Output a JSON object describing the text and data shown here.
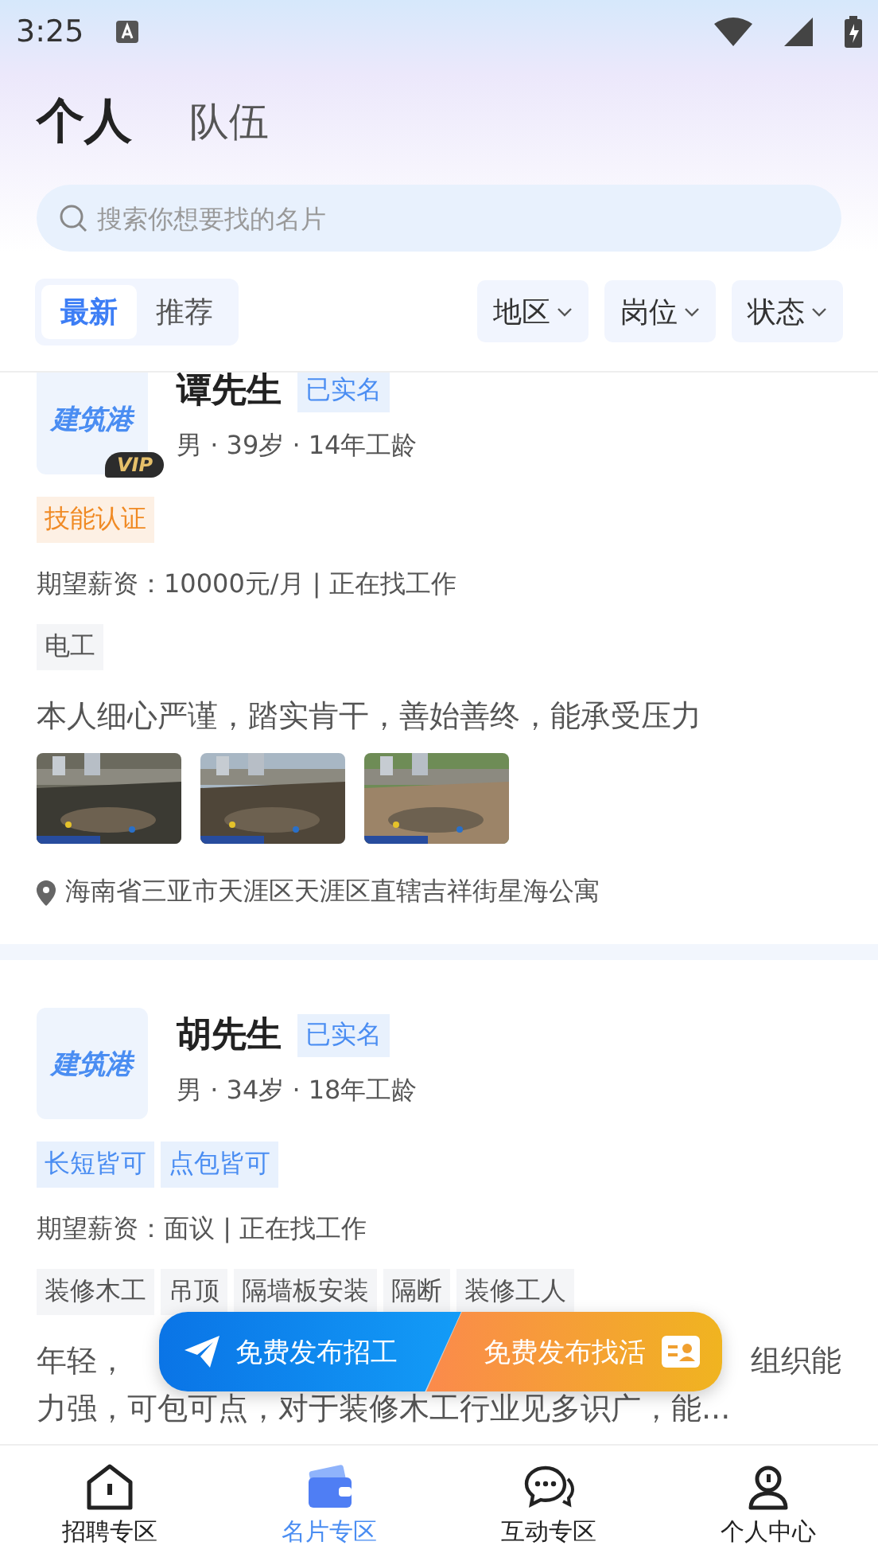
{
  "status_bar": {
    "time": "3:25"
  },
  "header": {
    "tabs": [
      {
        "label": "个人",
        "selected": true
      },
      {
        "label": "队伍",
        "selected": false
      }
    ]
  },
  "search": {
    "placeholder": "搜索你想要找的名片"
  },
  "sort_tabs": [
    {
      "label": "最新",
      "selected": true
    },
    {
      "label": "推荐",
      "selected": false
    }
  ],
  "filters": [
    "地区",
    "岗位",
    "状态"
  ],
  "cards": [
    {
      "avatar_text": "建筑港",
      "vip": true,
      "vip_label": "VIP",
      "name": "谭先生",
      "verified": "已实名",
      "meta": "男 · 39岁 · 14年工龄",
      "badges": [
        {
          "label": "技能认证",
          "kind": "skill"
        }
      ],
      "salary": "期望薪资：10000元/月 | 正在找工作",
      "work_tags": [
        "电工"
      ],
      "description": "本人细心严谨，踏实肯干，善始善终，能承受压力",
      "photos": [
        {
          "kind": "picture"
        },
        {
          "kind": "picture"
        },
        {
          "kind": "picture"
        }
      ],
      "location": "海南省三亚市天涯区天涯区直辖吉祥街星海公寓"
    },
    {
      "avatar_text": "建筑港",
      "vip": false,
      "name": "胡先生",
      "verified": "已实名",
      "meta": "男 · 34岁 · 18年工龄",
      "badges": [
        {
          "label": "长短皆可",
          "kind": "feature"
        },
        {
          "label": "点包皆可",
          "kind": "feature"
        }
      ],
      "salary": "期望薪资：面议 | 正在找工作",
      "work_tags": [
        "装修木工",
        "吊顶",
        "隔墙板安装",
        "隔断",
        "装修工人"
      ],
      "description_fragments": [
        "年轻，",
        "组织能"
      ],
      "description": "力强，可包可点，对于装修木工行业见多识广，能..."
    }
  ],
  "float_buttons": [
    {
      "label": "免费发布招工",
      "kind": "hire"
    },
    {
      "label": "免费发布找活",
      "kind": "work"
    }
  ],
  "bottom_nav": [
    {
      "label": "招聘专区",
      "selected": false
    },
    {
      "label": "名片专区",
      "selected": true
    },
    {
      "label": "互动专区",
      "selected": false
    },
    {
      "label": "个人中心",
      "selected": false
    }
  ]
}
